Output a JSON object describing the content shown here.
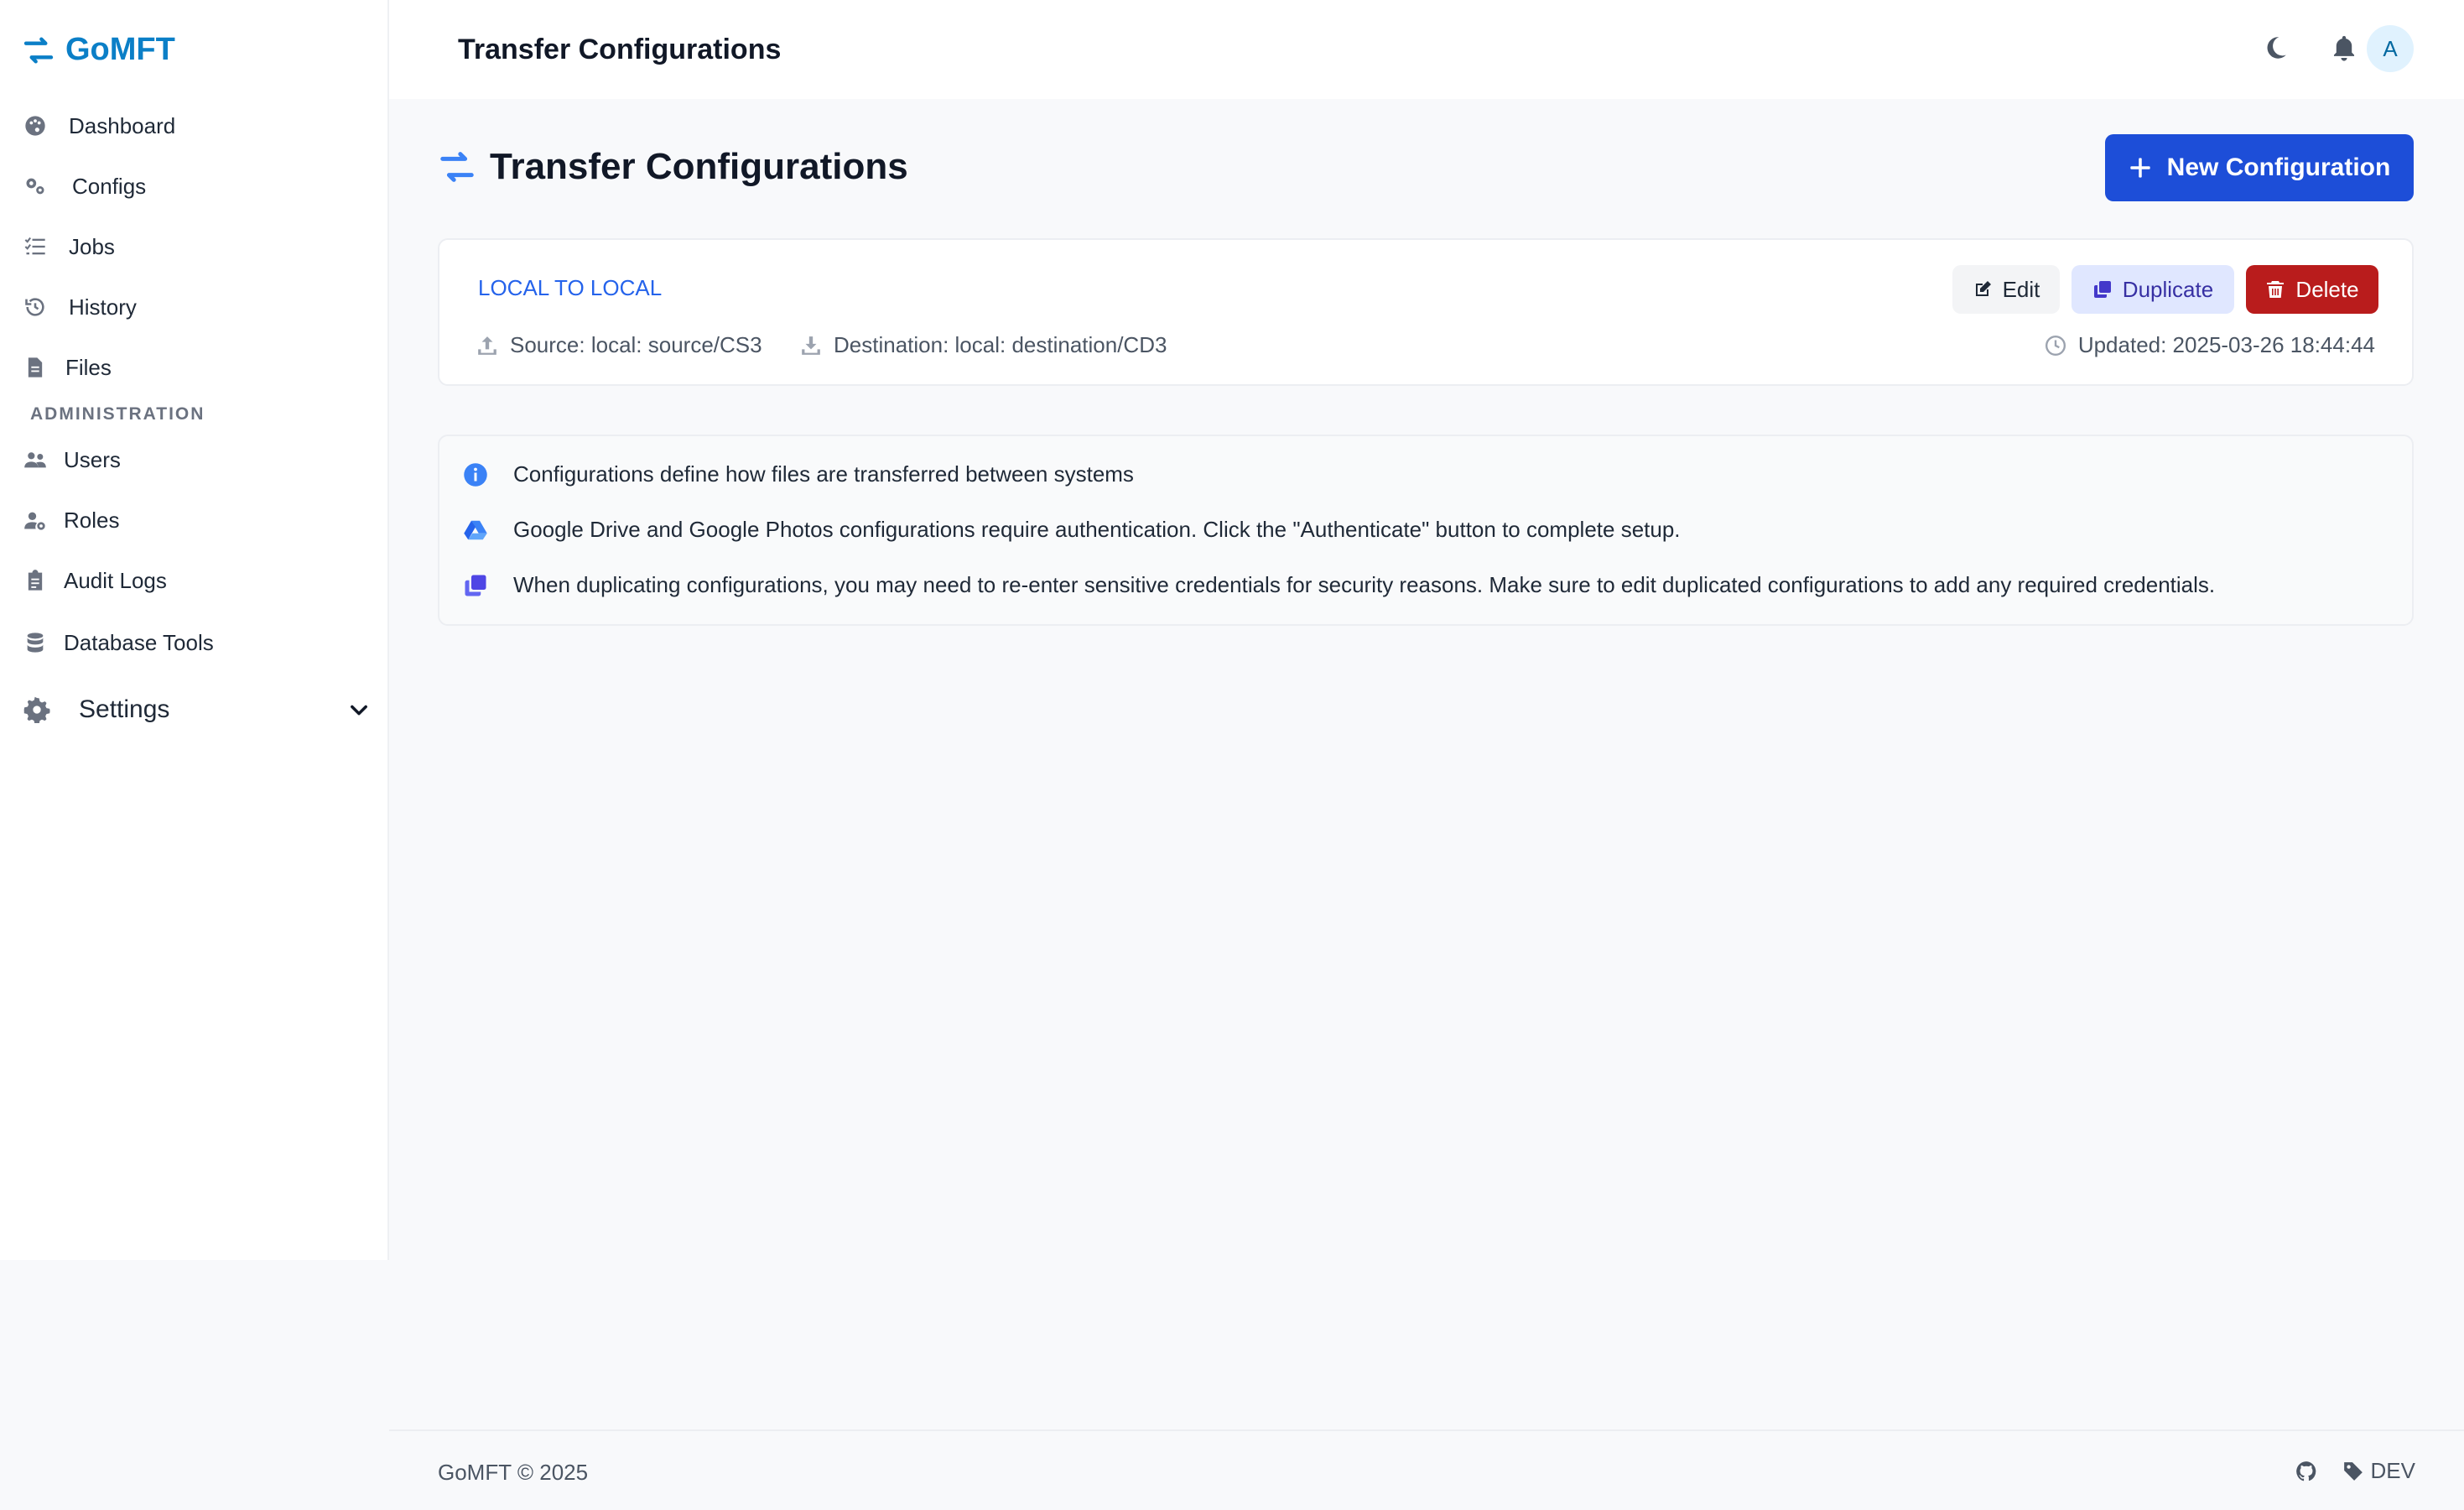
{
  "app": {
    "name": "GoMFT",
    "brand_color": "#0b7fc7"
  },
  "sidebar": {
    "items": [
      {
        "label": "Dashboard",
        "icon": "palette-icon"
      },
      {
        "label": "Configs",
        "icon": "gears-icon"
      },
      {
        "label": "Jobs",
        "icon": "list-check-icon"
      },
      {
        "label": "History",
        "icon": "history-icon"
      },
      {
        "label": "Files",
        "icon": "file-icon"
      }
    ],
    "section_label": "ADMINISTRATION",
    "admin_items": [
      {
        "label": "Users",
        "icon": "users-icon"
      },
      {
        "label": "Roles",
        "icon": "user-gear-icon"
      },
      {
        "label": "Audit Logs",
        "icon": "clipboard-icon"
      },
      {
        "label": "Database Tools",
        "icon": "database-icon"
      }
    ],
    "settings_label": "Settings"
  },
  "topbar": {
    "title": "Transfer Configurations",
    "avatar_initial": "A"
  },
  "main": {
    "heading": "Transfer Configurations",
    "new_button": "New Configuration",
    "accent_color": "#1d4ed8"
  },
  "config_card": {
    "name": "LOCAL TO LOCAL",
    "source": "Source: local: source/CS3",
    "destination": "Destination: local: destination/CD3",
    "updated": "Updated: 2025-03-26 18:44:44",
    "edit_label": "Edit",
    "duplicate_label": "Duplicate",
    "delete_label": "Delete",
    "delete_color": "#b91c1c"
  },
  "info": {
    "lines": [
      "Configurations define how files are transferred between systems",
      "Google Drive and Google Photos configurations require authentication. Click the \"Authenticate\" button to complete setup.",
      "When duplicating configurations, you may need to re-enter sensitive credentials for security reasons. Make sure to edit duplicated configurations to add any required credentials."
    ]
  },
  "footer": {
    "copyright": "GoMFT © 2025",
    "env_tag": "DEV"
  }
}
